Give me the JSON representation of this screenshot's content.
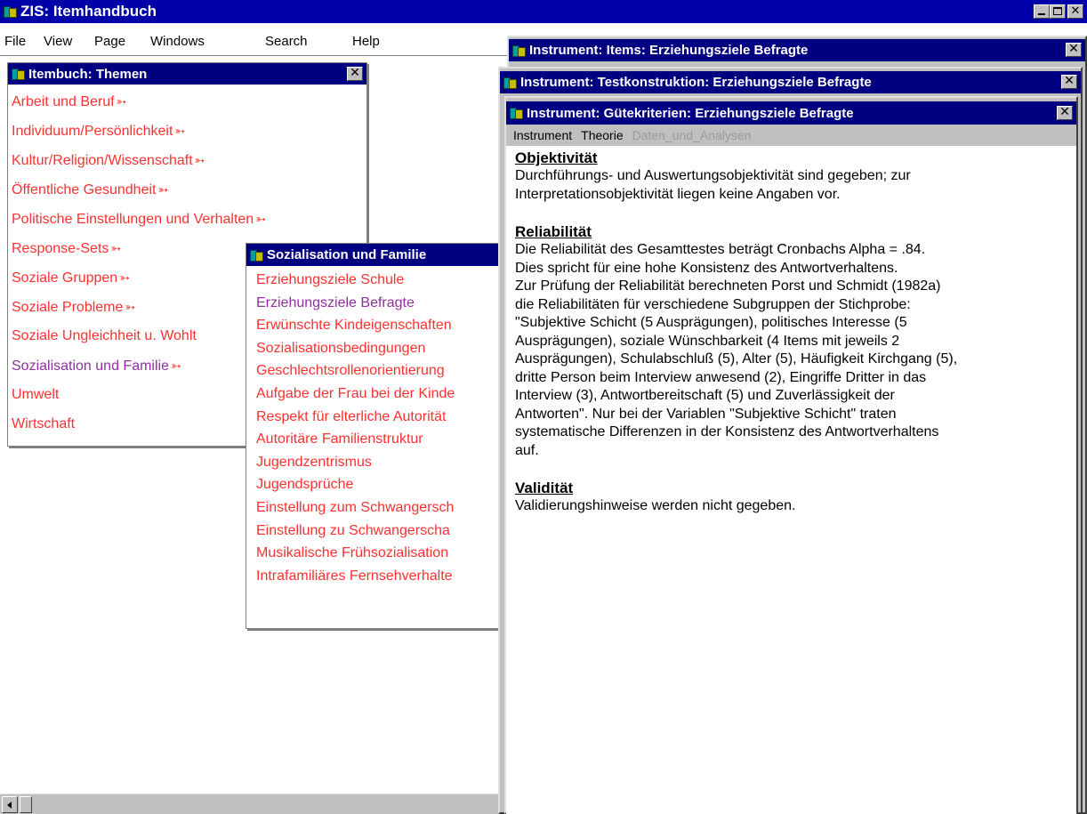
{
  "app": {
    "title": "ZIS: Itemhandbuch",
    "menu": [
      "File",
      "View",
      "Page",
      "Windows",
      "Search",
      "Help"
    ]
  },
  "themen": {
    "title": "Itembuch: Themen",
    "items": [
      "Arbeit und Beruf",
      "Individuum/Persönlichkeit",
      "Kultur/Religion/Wissenschaft",
      "Öffentliche Gesundheit",
      "Politische Einstellungen und Verhalten",
      "Response-Sets",
      "Soziale Gruppen",
      "Soziale Probleme",
      "Soziale Ungleichheit u. Wohlt",
      "Sozialisation und Familie",
      "Umwelt",
      "Wirtschaft"
    ]
  },
  "sozialisation": {
    "title": "Sozialisation und Familie",
    "items": [
      "Erziehungsziele Schule",
      "Erziehungsziele Befragte",
      "Erwünschte Kindeigenschaften",
      "Sozialisationsbedingungen",
      "Geschlechtsrollenorientierung",
      "Aufgabe der Frau bei der Kinde",
      "Respekt für elterliche Autorität",
      "Autoritäre Familienstruktur",
      "Jugendzentrismus",
      "Jugendsprüche",
      "Einstellung zum Schwangersch",
      "Einstellung zu Schwangerscha",
      "Musikalische Frühsozialisation",
      "Intrafamiliäres Fernsehverhalte"
    ]
  },
  "items_window": {
    "title": "Instrument: Items: Erziehungsziele Befragte"
  },
  "testkon_window": {
    "title": "Instrument: Testkonstruktion: Erziehungsziele Befragte"
  },
  "guete": {
    "title": "Instrument: Gütekriterien: Erziehungsziele Befragte",
    "menu": [
      "Instrument",
      "Theorie",
      "Daten_und_Analysen"
    ],
    "sections": [
      {
        "heading": "Objektivität",
        "lines": [
          "Durchführungs- und Auswertungsobjektivität sind gegeben; zur",
          "Interpretationsobjektivität liegen keine Angaben vor."
        ]
      },
      {
        "heading": "Reliabilität",
        "lines": [
          "Die Reliabilität des Gesamttestes beträgt Cronbachs Alpha = .84.",
          "Dies spricht für eine hohe Konsistenz des Antwortverhaltens.",
          "Zur Prüfung der Reliabilität berechneten Porst und Schmidt (1982a)",
          "die Reliabilitäten für verschiedene Subgruppen der Stichprobe:",
          "\"Subjektive Schicht (5 Ausprägungen), politisches Interesse (5",
          "Ausprägungen), soziale Wünschbarkeit (4 Items mit jeweils 2",
          "Ausprägungen), Schulabschluß (5), Alter (5), Häufigkeit Kirchgang (5),",
          "dritte Person beim Interview anwesend (2), Eingriffe Dritter in das",
          "Interview (3), Antwortbereitschaft (5) und Zuverlässigkeit der",
          "Antworten\".  Nur bei der Variablen \"Subjektive Schicht\" traten",
          "systematische Differenzen in der Konsistenz des Antwortverhaltens",
          "auf."
        ]
      },
      {
        "heading": "Validität",
        "lines": [
          "Validierungshinweise werden nicht gegeben."
        ]
      }
    ]
  }
}
